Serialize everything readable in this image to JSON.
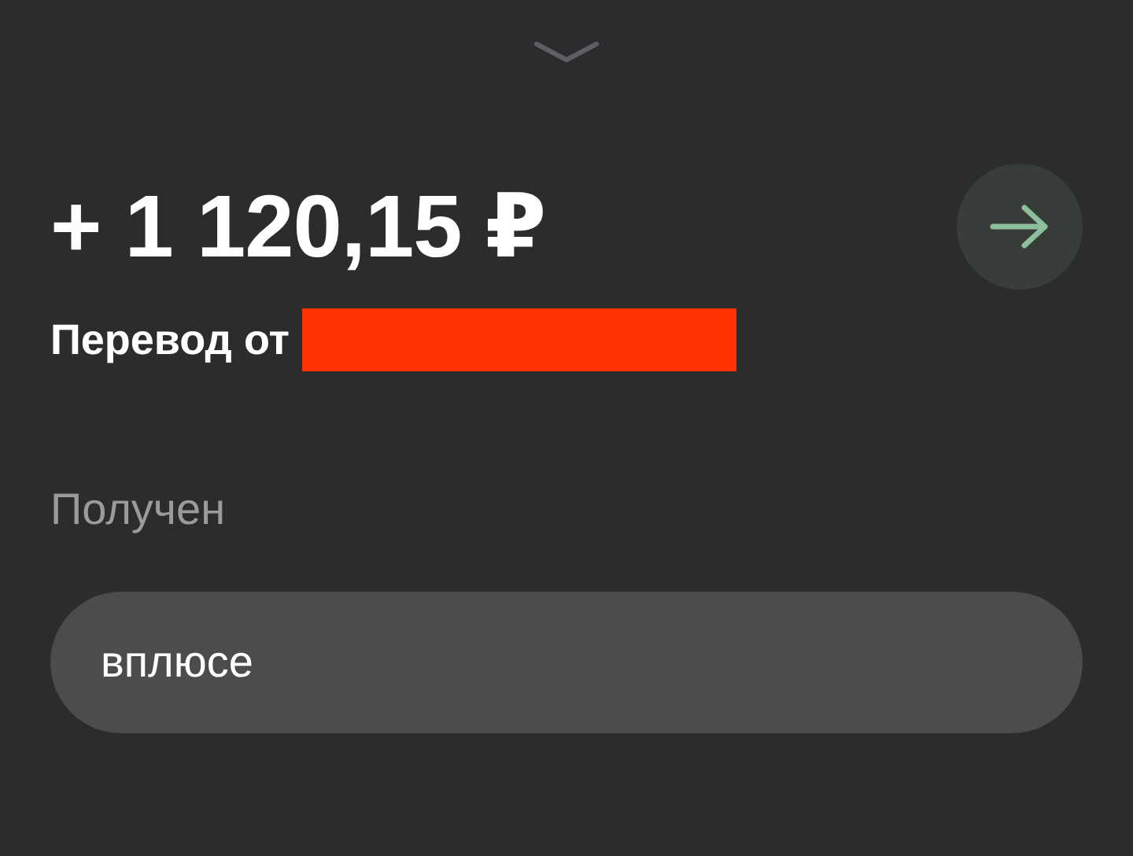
{
  "amount": "+ 1 120,15 ₽",
  "transfer": {
    "label": "Перевод от",
    "sender_redacted": true
  },
  "status": "Получен",
  "message": "вплюсе"
}
